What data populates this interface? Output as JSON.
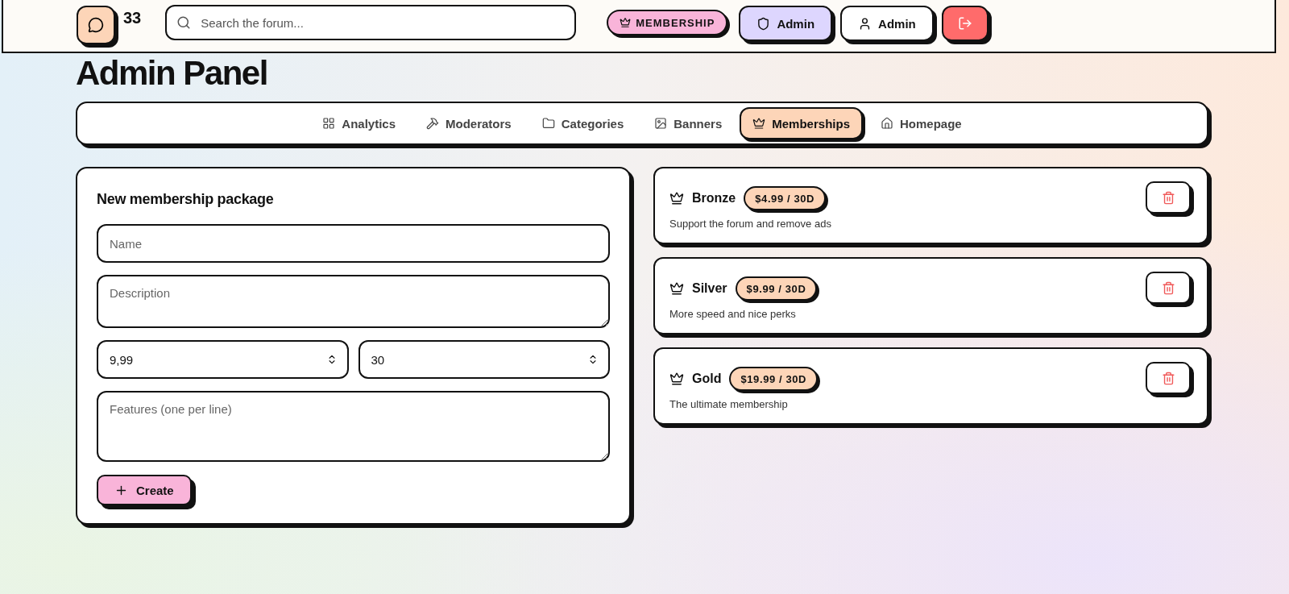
{
  "header": {
    "count": "33",
    "search": {
      "placeholder": "Search the forum..."
    },
    "membership_badge": "MEMBERSHIP",
    "admin_button": "Admin",
    "user_button": "Admin"
  },
  "title": "Admin Panel",
  "tabs": [
    {
      "label": "Analytics",
      "selected": false
    },
    {
      "label": "Moderators",
      "selected": false
    },
    {
      "label": "Categories",
      "selected": false
    },
    {
      "label": "Banners",
      "selected": false
    },
    {
      "label": "Memberships",
      "selected": true
    },
    {
      "label": "Homepage",
      "selected": false
    }
  ],
  "form": {
    "title": "New membership package",
    "name": {
      "placeholder": "Name"
    },
    "description": {
      "placeholder": "Description"
    },
    "price": {
      "value": "9,99"
    },
    "days": {
      "value": "30"
    },
    "features": {
      "placeholder": "Features (one per line)"
    },
    "create_button": "Create"
  },
  "packages": [
    {
      "name": "Bronze",
      "price": "$4.99 / 30D",
      "description": "Support the forum and remove ads"
    },
    {
      "name": "Silver",
      "price": "$9.99 / 30D",
      "description": "More speed and nice perks"
    },
    {
      "name": "Gold",
      "price": "$19.99 / 30D",
      "description": "The ultimate membership"
    }
  ]
}
